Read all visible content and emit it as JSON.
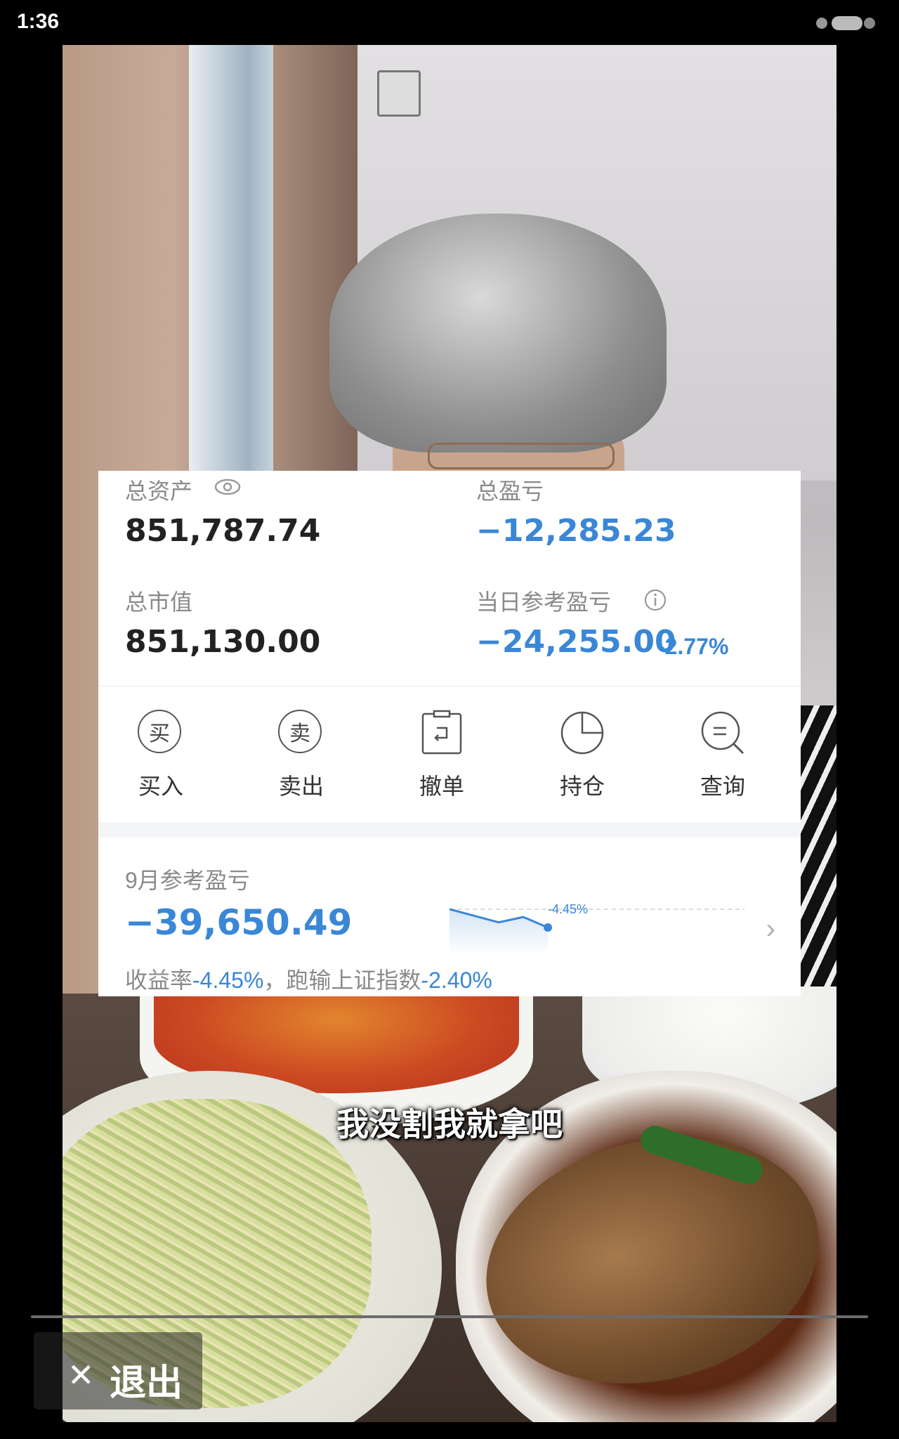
{
  "status_bar": {
    "time": "1:36"
  },
  "account": {
    "total_assets_label": "总资产",
    "total_assets": "851,787.74",
    "total_pl_label": "总盈亏",
    "total_pl": "−12,285.23",
    "market_value_label": "总市值",
    "market_value": "851,130.00",
    "daily_pl_label": "当日参考盈亏",
    "daily_pl": "−24,255.00",
    "daily_pl_pct": "-2.77%"
  },
  "actions": [
    {
      "label": "买入",
      "icon_char": "买",
      "icon": "buy-icon"
    },
    {
      "label": "卖出",
      "icon_char": "卖",
      "icon": "sell-icon"
    },
    {
      "label": "撤单",
      "icon": "cancel-order-icon"
    },
    {
      "label": "持仓",
      "icon": "pie-chart-icon"
    },
    {
      "label": "查询",
      "icon": "search-icon"
    }
  ],
  "monthly": {
    "label": "9月参考盈亏",
    "value": "−39,650.49",
    "spark_label": "-4.45%",
    "rate_prefix": "收益率",
    "rate_value": "-4.45%",
    "rate_sep": "，跑输上证指数",
    "index_value": "-2.40%"
  },
  "chart_data": {
    "type": "line",
    "series": [
      {
        "values": [
          0,
          -1.6,
          -3.2,
          -1.9,
          -4.45
        ]
      }
    ],
    "annotations": [
      "-4.45%"
    ]
  },
  "video": {
    "caption": "我没割我就拿吧"
  },
  "player": {
    "exit_label": "退出"
  },
  "colors": {
    "accent_blue": "#3a87d6",
    "text_gray": "#8a8a8a"
  }
}
